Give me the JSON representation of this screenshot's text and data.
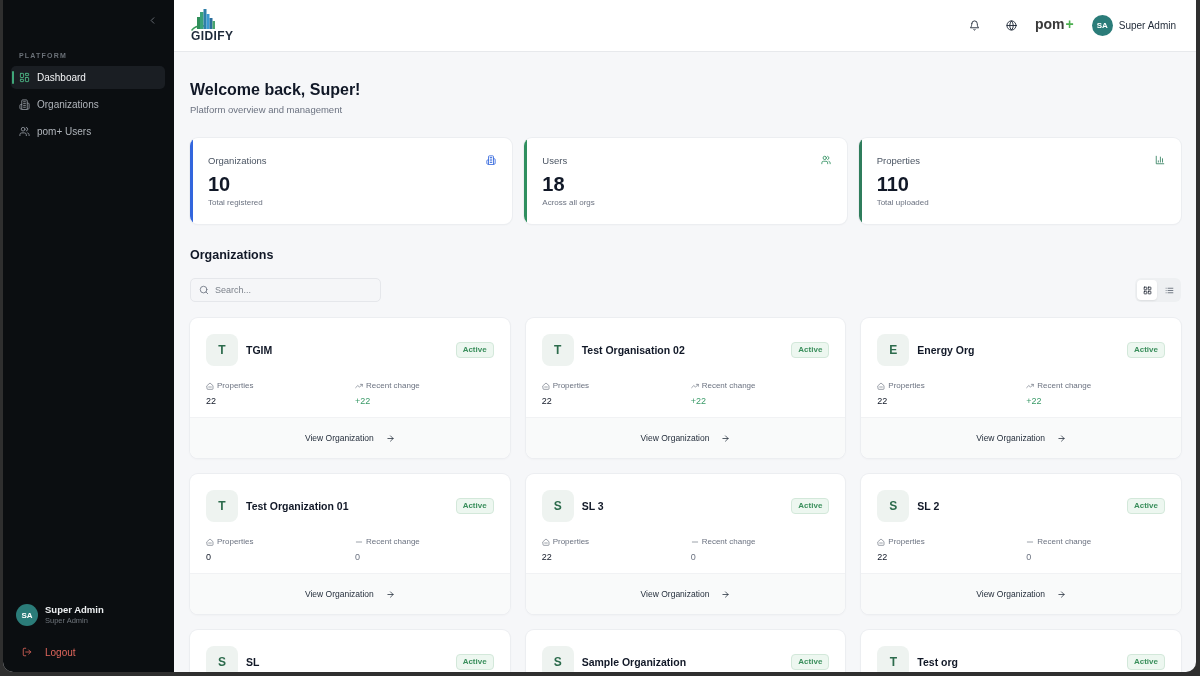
{
  "sidebar": {
    "section_label": "PLATFORM",
    "items": [
      {
        "label": "Dashboard",
        "selected": true
      },
      {
        "label": "Organizations",
        "selected": false
      },
      {
        "label": "pom+ Users",
        "selected": false
      }
    ],
    "user": {
      "initials": "SA",
      "name": "Super Admin",
      "role": "Super Admin"
    },
    "logout": "Logout"
  },
  "header": {
    "logo": "GIDIFY",
    "brand": {
      "name": "pom",
      "mark": "+"
    },
    "user": {
      "initials": "SA",
      "name": "Super Admin"
    }
  },
  "welcome": {
    "title": "Welcome back, Super!",
    "subtitle": "Platform overview and management"
  },
  "stat_cards": [
    {
      "label": "Organizations",
      "value": "10",
      "caption": "Total registered",
      "color": "#3366dd"
    },
    {
      "label": "Users",
      "value": "18",
      "caption": "Across all orgs",
      "color": "#2f8f5f"
    },
    {
      "label": "Properties",
      "value": "110",
      "caption": "Total uploaded",
      "color": "#2f7d5c"
    }
  ],
  "organizations": {
    "title": "Organizations",
    "search": {
      "placeholder": "Search..."
    },
    "view_modes": [
      {
        "selected": true
      },
      {
        "selected": false
      }
    ],
    "cards": [
      {
        "initial": "T",
        "name": "TGIM",
        "status": "Active",
        "properties_label": "Properties",
        "properties": "22",
        "change_label": "Recent change",
        "change": "+22",
        "rising": true,
        "link": "View Organization"
      },
      {
        "initial": "T",
        "name": "Test Organisation 02",
        "status": "Active",
        "properties_label": "Properties",
        "properties": "22",
        "change_label": "Recent change",
        "change": "+22",
        "rising": true,
        "link": "View Organization"
      },
      {
        "initial": "E",
        "name": "Energy Org",
        "status": "Active",
        "properties_label": "Properties",
        "properties": "22",
        "change_label": "Recent change",
        "change": "+22",
        "rising": true,
        "link": "View Organization"
      },
      {
        "initial": "T",
        "name": "Test Organization 01",
        "status": "Active",
        "properties_label": "Properties",
        "properties": "0",
        "change_label": "Recent change",
        "change": "0",
        "rising": false,
        "link": "View Organization"
      },
      {
        "initial": "S",
        "name": "SL 3",
        "status": "Active",
        "properties_label": "Properties",
        "properties": "22",
        "change_label": "Recent change",
        "change": "0",
        "rising": false,
        "link": "View Organization"
      },
      {
        "initial": "S",
        "name": "SL 2",
        "status": "Active",
        "properties_label": "Properties",
        "properties": "22",
        "change_label": "Recent change",
        "change": "0",
        "rising": false,
        "link": "View Organization"
      },
      {
        "initial": "S",
        "name": "SL",
        "status": "Active"
      },
      {
        "initial": "S",
        "name": "Sample Organization",
        "status": "Active"
      },
      {
        "initial": "T",
        "name": "Test org",
        "status": "Active"
      }
    ]
  }
}
